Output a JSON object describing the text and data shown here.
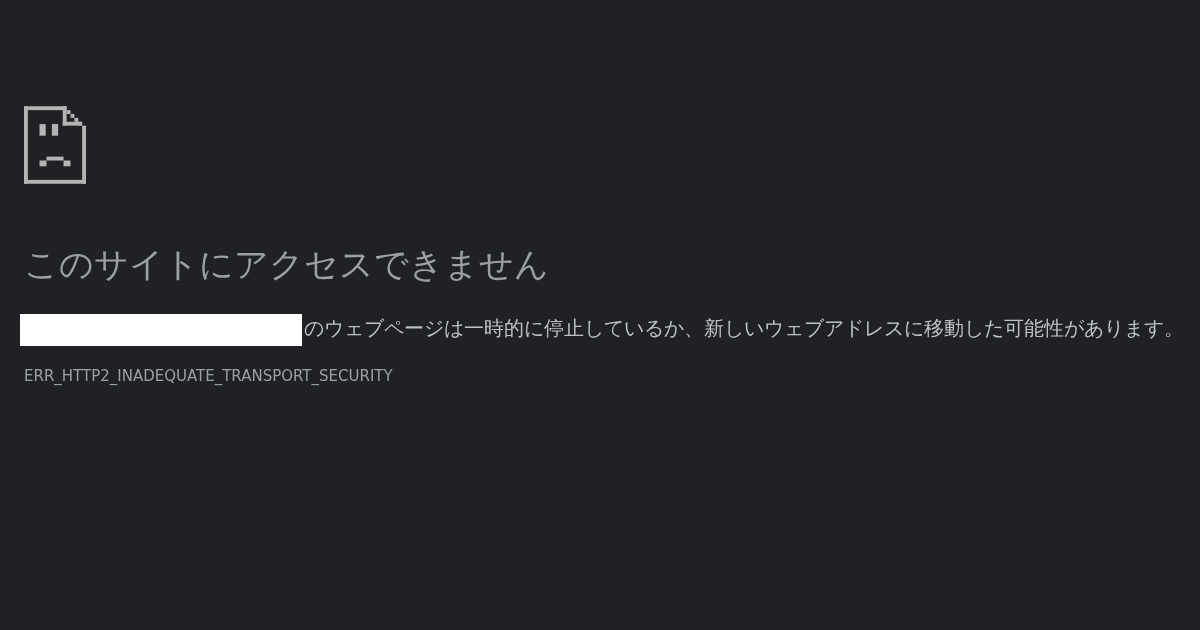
{
  "title": "このサイトにアクセスできません",
  "message": "のウェブページは一時的に停止しているか、新しいウェブアドレスに移動した可能性があります。",
  "error_code": "ERR_HTTP2_INADEQUATE_TRANSPORT_SECURITY"
}
